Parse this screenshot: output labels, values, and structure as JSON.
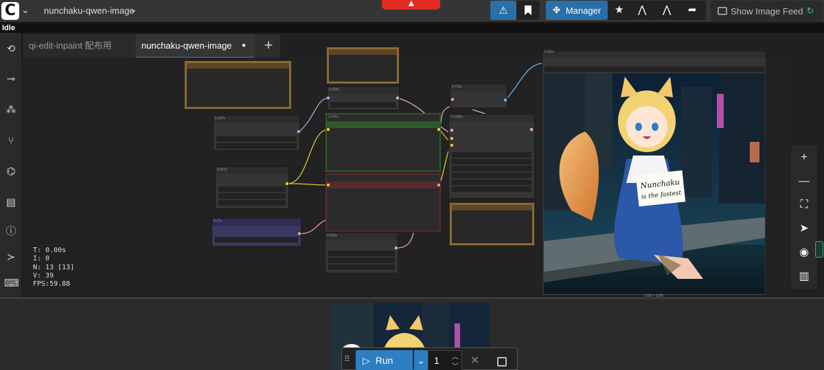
{
  "app": {
    "workflow_name": "nunchaku-qwen-image",
    "status": "Idle"
  },
  "toolbar": {
    "manager_label": "Manager",
    "show_feed_label": "Show Image Feed"
  },
  "tabs": [
    {
      "label": "qi-edit-inpaint 配布用",
      "active": false
    },
    {
      "label": "nunchaku-qwen-image",
      "active": true,
      "unsaved": true
    }
  ],
  "canvas_stats": {
    "t": "T: 0.00s",
    "i": "I: 0",
    "n": "N: 13 [13]",
    "v": "V: 39",
    "fps": "FPS:59.88"
  },
  "image_card": {
    "sign_line1": "Nunchaku",
    "sign_line2": "is the fastest",
    "size_label": "1328 × 1328"
  },
  "run_bar": {
    "run_label": "Run",
    "batch_count": "1"
  },
  "node_ids": [
    "5.147s",
    "0.003s",
    "3.476s",
    "3.557s",
    "3.27s",
    "0.006s",
    "4.722s",
    "77.690s",
    "3.492s"
  ],
  "colors": {
    "accent_blue": "#2a6fa8",
    "run_blue": "#2d7ec2",
    "red": "#e02c23",
    "group_brown": "#8b6a34",
    "node_green": "#2e5a2a",
    "node_red": "#5a2b2b",
    "node_purple": "#3a3760"
  },
  "icons": {
    "sidebar": [
      "history-icon",
      "nodes-icon",
      "model-library-icon",
      "workflows-icon",
      "node-tree-icon",
      "templates-icon",
      "help-icon",
      "terminal-icon",
      "keyboard-icon"
    ],
    "right_toolbar": [
      "zoom-in-icon",
      "zoom-out-icon",
      "fit-view-icon",
      "select-mode-icon",
      "visibility-icon",
      "minimap-icon"
    ]
  }
}
